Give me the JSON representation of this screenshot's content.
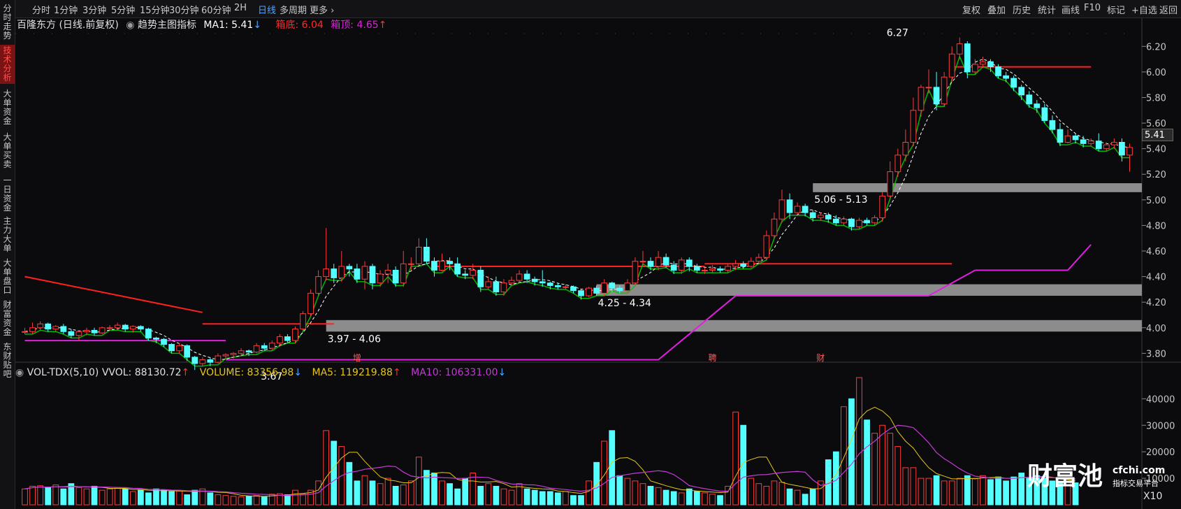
{
  "sidebar": {
    "items": [
      {
        "label": "分时走势",
        "active": false
      },
      {
        "label": "技术分析",
        "active": true
      },
      {
        "label": "大单资金",
        "active": false
      },
      {
        "label": "大单买卖",
        "active": false
      },
      {
        "label": "一日资金",
        "active": false
      },
      {
        "label": "主力大单",
        "active": false
      },
      {
        "label": "大单盘口",
        "active": false
      },
      {
        "label": "财富资金",
        "active": false
      },
      {
        "label": "东财贴吧",
        "active": false
      }
    ]
  },
  "toolbar": {
    "periods": [
      "分时",
      "1分钟",
      "3分钟",
      "5分钟",
      "15分钟",
      "30分钟",
      "60分钟",
      "2H",
      "日线",
      "多周期",
      "更多"
    ],
    "active_period": "日线",
    "right_buttons": [
      "复权",
      "叠加",
      "历史",
      "统计",
      "画线",
      "F10",
      "标记",
      "+自选",
      "返回"
    ]
  },
  "main_legend": {
    "stock": "百隆东方 (日线.前复权)",
    "indicator": "趋势主图指标",
    "ma1": "MA1: 5.41",
    "box_bottom": "箱底: 6.04",
    "box_top": "箱顶: 4.65"
  },
  "vol_legend": {
    "name": "VOL-TDX(5,10)",
    "vvol": "VVOL: 88130.72",
    "volume": "VOLUME: 83356.98",
    "ma5": "MA5: 119219.88",
    "ma10": "MA10: 106331.00"
  },
  "current_price": "5.41",
  "colors": {
    "up": "#ff3b3b",
    "down": "#54ffff",
    "ma1": "#ffffff",
    "box_line": "#ff2020",
    "magenta": "#e020e0",
    "green_band": "#00c800",
    "zone": "#8c8c8c",
    "vol_ma5": "#e6c619",
    "vol_ma10": "#c23bd4",
    "active_tab": "#4aa3ff"
  },
  "event_markers": [
    "增",
    "聘",
    "财"
  ],
  "watermark": {
    "cn": "财富池",
    "site": "cfchi.com",
    "sub": "指标交易平台"
  },
  "vol_unit": "X10",
  "chart_data": [
    {
      "type": "candlestick",
      "title": "百隆东方 (日线.前复权)",
      "y_ticks": [
        6.2,
        6.0,
        5.8,
        5.6,
        5.4,
        5.2,
        5.0,
        4.8,
        4.6,
        4.4,
        4.2,
        4.0,
        3.8
      ],
      "ylim": [
        3.72,
        6.3
      ],
      "candles": [
        [
          3.97,
          3.97,
          4.0,
          3.95
        ],
        [
          3.97,
          4.0,
          4.04,
          3.95
        ],
        [
          4.0,
          4.03,
          4.05,
          3.98
        ],
        [
          4.03,
          3.99,
          4.04,
          3.97
        ],
        [
          3.99,
          4.01,
          4.02,
          3.97
        ],
        [
          4.01,
          3.97,
          4.03,
          3.95
        ],
        [
          3.97,
          3.94,
          3.99,
          3.92
        ],
        [
          3.94,
          3.97,
          3.98,
          3.9
        ],
        [
          3.97,
          3.98,
          4.0,
          3.94
        ],
        [
          3.98,
          3.96,
          4.0,
          3.94
        ],
        [
          3.96,
          4.0,
          4.01,
          3.95
        ],
        [
          4.0,
          4.0,
          4.02,
          3.98
        ],
        [
          4.0,
          4.02,
          4.04,
          3.98
        ],
        [
          4.02,
          3.99,
          4.03,
          3.97
        ],
        [
          3.99,
          4.01,
          4.02,
          3.96
        ],
        [
          4.01,
          3.99,
          4.02,
          3.97
        ],
        [
          3.99,
          3.92,
          4.0,
          3.9
        ],
        [
          3.92,
          3.91,
          3.93,
          3.88
        ],
        [
          3.91,
          3.87,
          3.92,
          3.85
        ],
        [
          3.87,
          3.82,
          3.88,
          3.8
        ],
        [
          3.82,
          3.86,
          3.88,
          3.8
        ],
        [
          3.86,
          3.77,
          3.87,
          3.74
        ],
        [
          3.77,
          3.72,
          3.78,
          3.67
        ],
        [
          3.72,
          3.75,
          3.77,
          3.7
        ],
        [
          3.75,
          3.73,
          3.77,
          3.7
        ],
        [
          3.73,
          3.78,
          3.8,
          3.72
        ],
        [
          3.78,
          3.79,
          3.8,
          3.76
        ],
        [
          3.79,
          3.8,
          3.81,
          3.76
        ],
        [
          3.8,
          3.82,
          3.84,
          3.78
        ],
        [
          3.82,
          3.81,
          3.83,
          3.78
        ],
        [
          3.81,
          3.86,
          3.88,
          3.8
        ],
        [
          3.86,
          3.84,
          3.88,
          3.82
        ],
        [
          3.84,
          3.88,
          3.9,
          3.82
        ],
        [
          3.88,
          3.93,
          3.95,
          3.85
        ],
        [
          3.93,
          3.9,
          3.95,
          3.88
        ],
        [
          3.9,
          3.99,
          4.01,
          3.88
        ],
        [
          3.99,
          4.11,
          4.13,
          3.97
        ],
        [
          4.11,
          4.27,
          4.3,
          4.09
        ],
        [
          4.27,
          4.4,
          4.45,
          4.25
        ],
        [
          4.4,
          4.46,
          4.78,
          4.37
        ],
        [
          4.46,
          4.39,
          4.5,
          4.35
        ],
        [
          4.39,
          4.48,
          4.6,
          4.36
        ],
        [
          4.48,
          4.46,
          4.5,
          4.4
        ],
        [
          4.46,
          4.38,
          4.5,
          4.35
        ],
        [
          4.38,
          4.48,
          4.52,
          4.3
        ],
        [
          4.48,
          4.35,
          4.5,
          4.3
        ],
        [
          4.35,
          4.42,
          4.45,
          4.32
        ],
        [
          4.42,
          4.45,
          4.5,
          4.35
        ],
        [
          4.45,
          4.35,
          4.48,
          4.32
        ],
        [
          4.35,
          4.5,
          4.6,
          4.32
        ],
        [
          4.5,
          4.5,
          4.55,
          4.45
        ],
        [
          4.5,
          4.63,
          4.7,
          4.48
        ],
        [
          4.63,
          4.52,
          4.7,
          4.5
        ],
        [
          4.52,
          4.45,
          4.55,
          4.4
        ],
        [
          4.45,
          4.52,
          4.58,
          4.44
        ],
        [
          4.52,
          4.5,
          4.55,
          4.45
        ],
        [
          4.5,
          4.42,
          4.55,
          4.4
        ],
        [
          4.42,
          4.41,
          4.45,
          4.38
        ],
        [
          4.41,
          4.45,
          4.5,
          4.38
        ],
        [
          4.45,
          4.32,
          4.48,
          4.28
        ],
        [
          4.32,
          4.36,
          4.4,
          4.3
        ],
        [
          4.36,
          4.28,
          4.4,
          4.25
        ],
        [
          4.28,
          4.35,
          4.38,
          4.25
        ],
        [
          4.35,
          4.37,
          4.4,
          4.33
        ],
        [
          4.37,
          4.42,
          4.45,
          4.35
        ],
        [
          4.42,
          4.38,
          4.45,
          4.35
        ],
        [
          4.38,
          4.36,
          4.4,
          4.33
        ],
        [
          4.36,
          4.35,
          4.45,
          4.32
        ],
        [
          4.35,
          4.33,
          4.36,
          4.3
        ],
        [
          4.33,
          4.32,
          4.35,
          4.3
        ],
        [
          4.32,
          4.32,
          4.34,
          4.3
        ],
        [
          4.32,
          4.29,
          4.33,
          4.27
        ],
        [
          4.29,
          4.25,
          4.3,
          4.22
        ],
        [
          4.25,
          4.31,
          4.32,
          4.24
        ],
        [
          4.31,
          4.27,
          4.33,
          4.25
        ],
        [
          4.27,
          4.35,
          4.38,
          4.25
        ],
        [
          4.35,
          4.31,
          4.36,
          4.28
        ],
        [
          4.31,
          4.29,
          4.33,
          4.27
        ],
        [
          4.29,
          4.35,
          4.38,
          4.27
        ],
        [
          4.35,
          4.52,
          4.55,
          4.33
        ],
        [
          4.52,
          4.52,
          4.6,
          4.48
        ],
        [
          4.52,
          4.48,
          4.55,
          4.45
        ],
        [
          4.48,
          4.55,
          4.6,
          4.45
        ],
        [
          4.55,
          4.49,
          4.58,
          4.47
        ],
        [
          4.49,
          4.45,
          4.52,
          4.42
        ],
        [
          4.45,
          4.53,
          4.55,
          4.42
        ],
        [
          4.53,
          4.48,
          4.55,
          4.44
        ],
        [
          4.48,
          4.45,
          4.5,
          4.43
        ],
        [
          4.45,
          4.45,
          4.48,
          4.42
        ],
        [
          4.45,
          4.46,
          4.49,
          4.43
        ],
        [
          4.46,
          4.45,
          4.48,
          4.43
        ],
        [
          4.45,
          4.48,
          4.5,
          4.43
        ],
        [
          4.48,
          4.5,
          4.53,
          4.45
        ],
        [
          4.5,
          4.48,
          4.52,
          4.46
        ],
        [
          4.48,
          4.52,
          4.55,
          4.47
        ],
        [
          4.52,
          4.55,
          4.58,
          4.5
        ],
        [
          4.55,
          4.72,
          4.76,
          4.53
        ],
        [
          4.72,
          4.85,
          4.9,
          4.7
        ],
        [
          4.85,
          5.0,
          5.08,
          4.82
        ],
        [
          5.0,
          4.9,
          5.05,
          4.85
        ],
        [
          4.9,
          4.95,
          4.98,
          4.88
        ],
        [
          4.95,
          4.9,
          4.97,
          4.87
        ],
        [
          4.9,
          4.86,
          4.92,
          4.83
        ],
        [
          4.86,
          4.88,
          4.9,
          4.84
        ],
        [
          4.88,
          4.85,
          4.9,
          4.82
        ],
        [
          4.85,
          4.82,
          4.88,
          4.8
        ],
        [
          4.82,
          4.85,
          4.87,
          4.8
        ],
        [
          4.85,
          4.79,
          4.86,
          4.76
        ],
        [
          4.79,
          4.84,
          4.86,
          4.77
        ],
        [
          4.84,
          4.82,
          4.86,
          4.8
        ],
        [
          4.82,
          4.86,
          4.88,
          4.8
        ],
        [
          4.86,
          5.03,
          5.06,
          4.83
        ],
        [
          5.03,
          5.22,
          5.3,
          5.0
        ],
        [
          5.22,
          5.35,
          5.4,
          5.18
        ],
        [
          5.35,
          5.45,
          5.55,
          5.3
        ],
        [
          5.45,
          5.7,
          5.8,
          5.42
        ],
        [
          5.7,
          5.88,
          5.9,
          5.65
        ],
        [
          5.88,
          5.88,
          6.02,
          5.83
        ],
        [
          5.88,
          5.75,
          6.0,
          5.7
        ],
        [
          5.75,
          5.96,
          6.0,
          5.73
        ],
        [
          5.96,
          6.14,
          6.2,
          5.92
        ],
        [
          6.14,
          6.22,
          6.27,
          6.1
        ],
        [
          6.22,
          6.0,
          6.24,
          5.95
        ],
        [
          6.0,
          6.06,
          6.1,
          5.98
        ],
        [
          6.06,
          6.08,
          6.12,
          6.03
        ],
        [
          6.08,
          6.04,
          6.1,
          6.0
        ],
        [
          6.04,
          5.97,
          6.06,
          5.95
        ],
        [
          5.97,
          5.95,
          6.0,
          5.92
        ],
        [
          5.95,
          5.88,
          5.97,
          5.85
        ],
        [
          5.88,
          5.82,
          5.9,
          5.78
        ],
        [
          5.82,
          5.75,
          5.85,
          5.72
        ],
        [
          5.75,
          5.72,
          5.78,
          5.68
        ],
        [
          5.72,
          5.62,
          5.75,
          5.6
        ],
        [
          5.62,
          5.55,
          5.66,
          5.52
        ],
        [
          5.55,
          5.45,
          5.6,
          5.42
        ],
        [
          5.45,
          5.5,
          5.55,
          5.44
        ],
        [
          5.5,
          5.47,
          5.52,
          5.44
        ],
        [
          5.47,
          5.44,
          5.5,
          5.41
        ],
        [
          5.44,
          5.46,
          5.48,
          5.42
        ],
        [
          5.46,
          5.4,
          5.52,
          5.38
        ],
        [
          5.4,
          5.43,
          5.45,
          5.38
        ],
        [
          5.43,
          5.45,
          5.48,
          5.4
        ],
        [
          5.45,
          5.35,
          5.48,
          5.3
        ],
        [
          5.35,
          5.41,
          5.44,
          5.22
        ]
      ],
      "box_line": [
        {
          "from": 0,
          "to": 23,
          "values": [
            4.4,
            4.12
          ]
        },
        {
          "from": 23,
          "to": 40,
          "value": 4.03
        },
        {
          "from": 53,
          "to": 88,
          "value": 4.48
        },
        {
          "from": 88,
          "to": 120,
          "value": 4.5
        },
        {
          "from": 120,
          "to": 138,
          "value": 6.04
        }
      ],
      "magenta_line": [
        {
          "from": 0,
          "to": 26,
          "value": 3.9
        },
        {
          "from": 26,
          "to": 82,
          "value": 3.75
        },
        {
          "from": 82,
          "to": 92,
          "values": [
            3.75,
            4.25
          ]
        },
        {
          "from": 92,
          "to": 117,
          "value": 4.25
        },
        {
          "from": 117,
          "to": 123,
          "values": [
            4.25,
            4.45
          ]
        },
        {
          "from": 123,
          "to": 135,
          "value": 4.45
        },
        {
          "from": 135,
          "to": 138,
          "values": [
            4.45,
            4.65
          ]
        }
      ],
      "zones": [
        {
          "low": 3.97,
          "high": 4.06,
          "start": 39,
          "label": "3.97 - 4.06"
        },
        {
          "low": 4.25,
          "high": 4.34,
          "start": 74,
          "label": "4.25 - 4.34"
        },
        {
          "low": 5.06,
          "high": 5.13,
          "start": 102,
          "label": "5.06 - 5.13"
        }
      ],
      "annotations": [
        {
          "label": "3.67",
          "x": 30,
          "y": 3.67
        },
        {
          "label": "6.27",
          "x": 111,
          "y": 6.27
        }
      ],
      "event_markers": [
        {
          "label": "增",
          "x": 43
        },
        {
          "label": "聘",
          "x": 89
        },
        {
          "label": "财",
          "x": 103
        }
      ]
    },
    {
      "type": "bar",
      "title": "VOL-TDX(5,10)",
      "y_ticks": [
        40000,
        30000,
        20000,
        10000
      ],
      "ylim": [
        0,
        48000
      ],
      "unit": "X10",
      "values": [
        6000,
        7000,
        7200,
        6500,
        7500,
        6000,
        8000,
        6500,
        6000,
        7000,
        5500,
        6000,
        6500,
        6000,
        5000,
        5500,
        4500,
        6000,
        5500,
        5000,
        5200,
        3800,
        5500,
        6000,
        4500,
        3800,
        3500,
        3200,
        3000,
        3300,
        3500,
        3000,
        4000,
        4200,
        3800,
        5500,
        4000,
        5500,
        9000,
        28000,
        24000,
        22000,
        16000,
        9000,
        11000,
        9000,
        8000,
        10000,
        7000,
        7500,
        9000,
        18000,
        13000,
        12000,
        9000,
        8000,
        6000,
        10000,
        12000,
        7000,
        8000,
        7000,
        6000,
        5500,
        8000,
        6000,
        5500,
        5000,
        5000,
        4500,
        5000,
        3500,
        3500,
        9000,
        16000,
        24000,
        28000,
        11000,
        10000,
        9000,
        8000,
        7000,
        6500,
        5500,
        5000,
        4500,
        6000,
        5000,
        4500,
        4000,
        3500,
        7000,
        35000,
        30000,
        10000,
        8000,
        7000,
        9000,
        8500,
        6000,
        5500,
        4000,
        6000,
        9000,
        17000,
        20000,
        37000,
        40000,
        48000,
        32000,
        27000,
        30000,
        27000,
        22000,
        14000,
        14000,
        10000,
        10000,
        11000,
        9000,
        9000,
        10000,
        11000,
        10000,
        11000,
        9500,
        10500,
        9000,
        10500,
        12000,
        10000,
        11000,
        10000,
        9000,
        8500,
        9000,
        8300
      ],
      "up_flags_note": "colors follow price candles"
    }
  ]
}
